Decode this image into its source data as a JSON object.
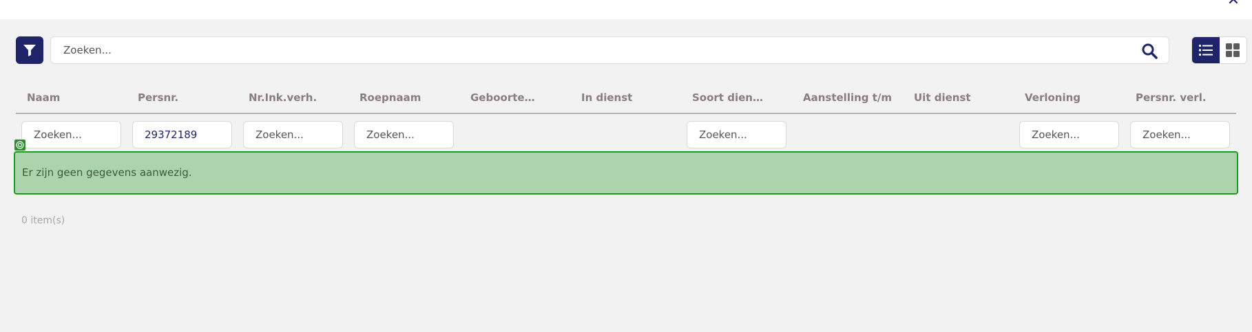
{
  "toolbar": {
    "search_placeholder": "Zoeken...",
    "filter_icon": "filter-funnel-icon",
    "search_icon": "search-magnifier-icon",
    "view_list_icon": "list-view-icon",
    "view_grid_icon": "grid-view-icon"
  },
  "table": {
    "columns": [
      "Naam",
      "Persnr.",
      "Nr.Ink.verh.",
      "Roepnaam",
      "Geboortedatum",
      "In dienst",
      "Soort dienstverband",
      "Aanstelling t/m",
      "Uit dienst",
      "Verloning",
      "Persnr. verl."
    ],
    "filters": {
      "naam": {
        "value": "",
        "placeholder": "Zoeken..."
      },
      "persnr": {
        "value": "29372189",
        "placeholder": "Zoeken..."
      },
      "nr_ink_verh": {
        "value": "",
        "placeholder": "Zoeken..."
      },
      "roepnaam": {
        "value": "",
        "placeholder": "Zoeken..."
      },
      "soort_dienstverband": {
        "value": "",
        "placeholder": "Zoeken..."
      },
      "verloning": {
        "value": "",
        "placeholder": "Zoeken..."
      },
      "persnr_verl": {
        "value": "",
        "placeholder": "Zoeken..."
      }
    },
    "empty_message": "Er zijn geen gegevens aanwezig.",
    "item_count": "0 item(s)"
  },
  "colors": {
    "accent": "#1f2468",
    "panel_bg": "#f2f2f2",
    "success_bg": "#acd4ac",
    "success_border": "#1f9b1f",
    "header_text": "#8a7d7d"
  }
}
